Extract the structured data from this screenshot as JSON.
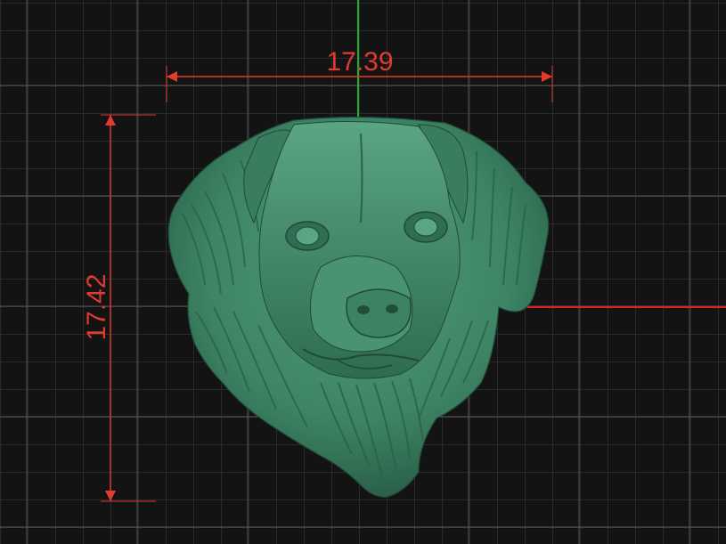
{
  "viewport": {
    "model_name": "dog-head-relief",
    "colors": {
      "background": "#131313",
      "grid_minor": "#2a2a2a",
      "grid_major": "#5a5a5a",
      "dimension": "#e23a2e",
      "axis_x": "#e0231b",
      "axis_y": "#1fae2a",
      "model": "#3f8a69"
    }
  },
  "dimensions": {
    "width": {
      "value": "17.39"
    },
    "height": {
      "value": "17.42"
    }
  }
}
